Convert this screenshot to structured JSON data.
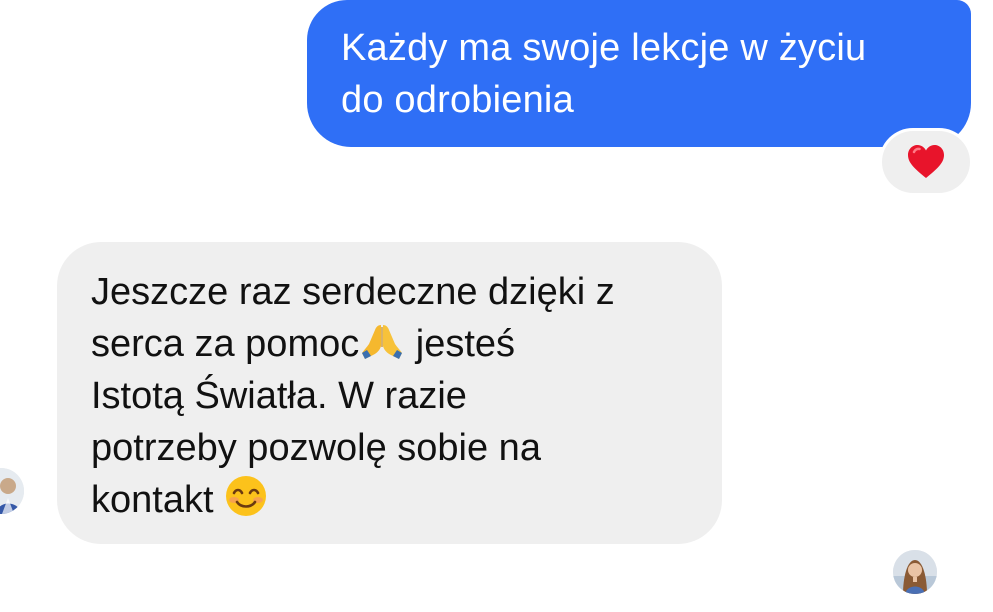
{
  "messages": {
    "outgoing": {
      "lines": [
        "Każdy ma swoje lekcje w życiu",
        "do odrobienia"
      ],
      "color": "#2f6ff6",
      "reaction_icon": "red-heart-icon"
    },
    "incoming": {
      "line1": "Jeszcze raz serdeczne dzięki z",
      "line2_before": "serca za pomoc",
      "line2_emoji": "folded-hands-icon",
      "line2_after": " jesteś",
      "line3": "Istotą Światła. W razie",
      "line4": "potrzeby pozwolę sobie na",
      "line5_before": "kontakt ",
      "line5_emoji": "smiling-face-icon",
      "color": "#efefef"
    }
  },
  "avatars": {
    "sender": "sender-avatar",
    "seen": "seen-avatar"
  }
}
